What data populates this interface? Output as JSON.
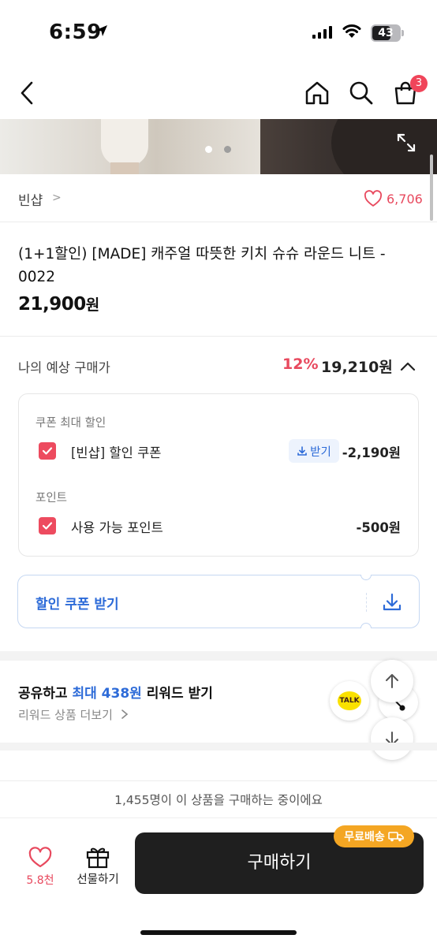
{
  "status_bar": {
    "time": "6:59",
    "battery": "43"
  },
  "nav": {
    "cart_count": "3"
  },
  "hero": {
    "pager": {
      "pages": 2,
      "current": 1
    }
  },
  "shop": {
    "name": "빈샵",
    "chevron": ">",
    "likes": "6,706"
  },
  "product": {
    "title": "(1+1할인) [MADE] 캐주얼 따뜻한 키치 슈슈 라운드 니트 - 0022",
    "price": "21,900",
    "price_unit": "원"
  },
  "expected": {
    "label": "나의 예상 구매가",
    "discount_pct": "12%",
    "price": "19,210원"
  },
  "discounts": {
    "coupon_section": "쿠폰 최대 할인",
    "coupon_item": "[빈샵] 할인 쿠폰",
    "receive_label": "받기",
    "coupon_amount": "-2,190원",
    "point_section": "포인트",
    "point_item": "사용 가능 포인트",
    "point_amount": "-500원"
  },
  "coupon_button": {
    "label": "할인 쿠폰 받기"
  },
  "reward": {
    "title_prefix": "공유하고 ",
    "title_highlight": "최대 438원",
    "title_suffix": " 리워드 받기",
    "more": "리워드 상품 더보기",
    "talk_label": "TALK"
  },
  "bottom": {
    "buyers": "1,455명이 이 상품을 구매하는 중이에요",
    "wish_count": "5.8천",
    "gift_label": "선물하기",
    "buy_label": "구매하기",
    "free_shipping": "무료배송"
  },
  "colors": {
    "accent_red": "#e8495e",
    "accent_blue": "#2d6bd8",
    "shipping_orange": "#f4a623",
    "buy_button": "#1f1f1f"
  }
}
